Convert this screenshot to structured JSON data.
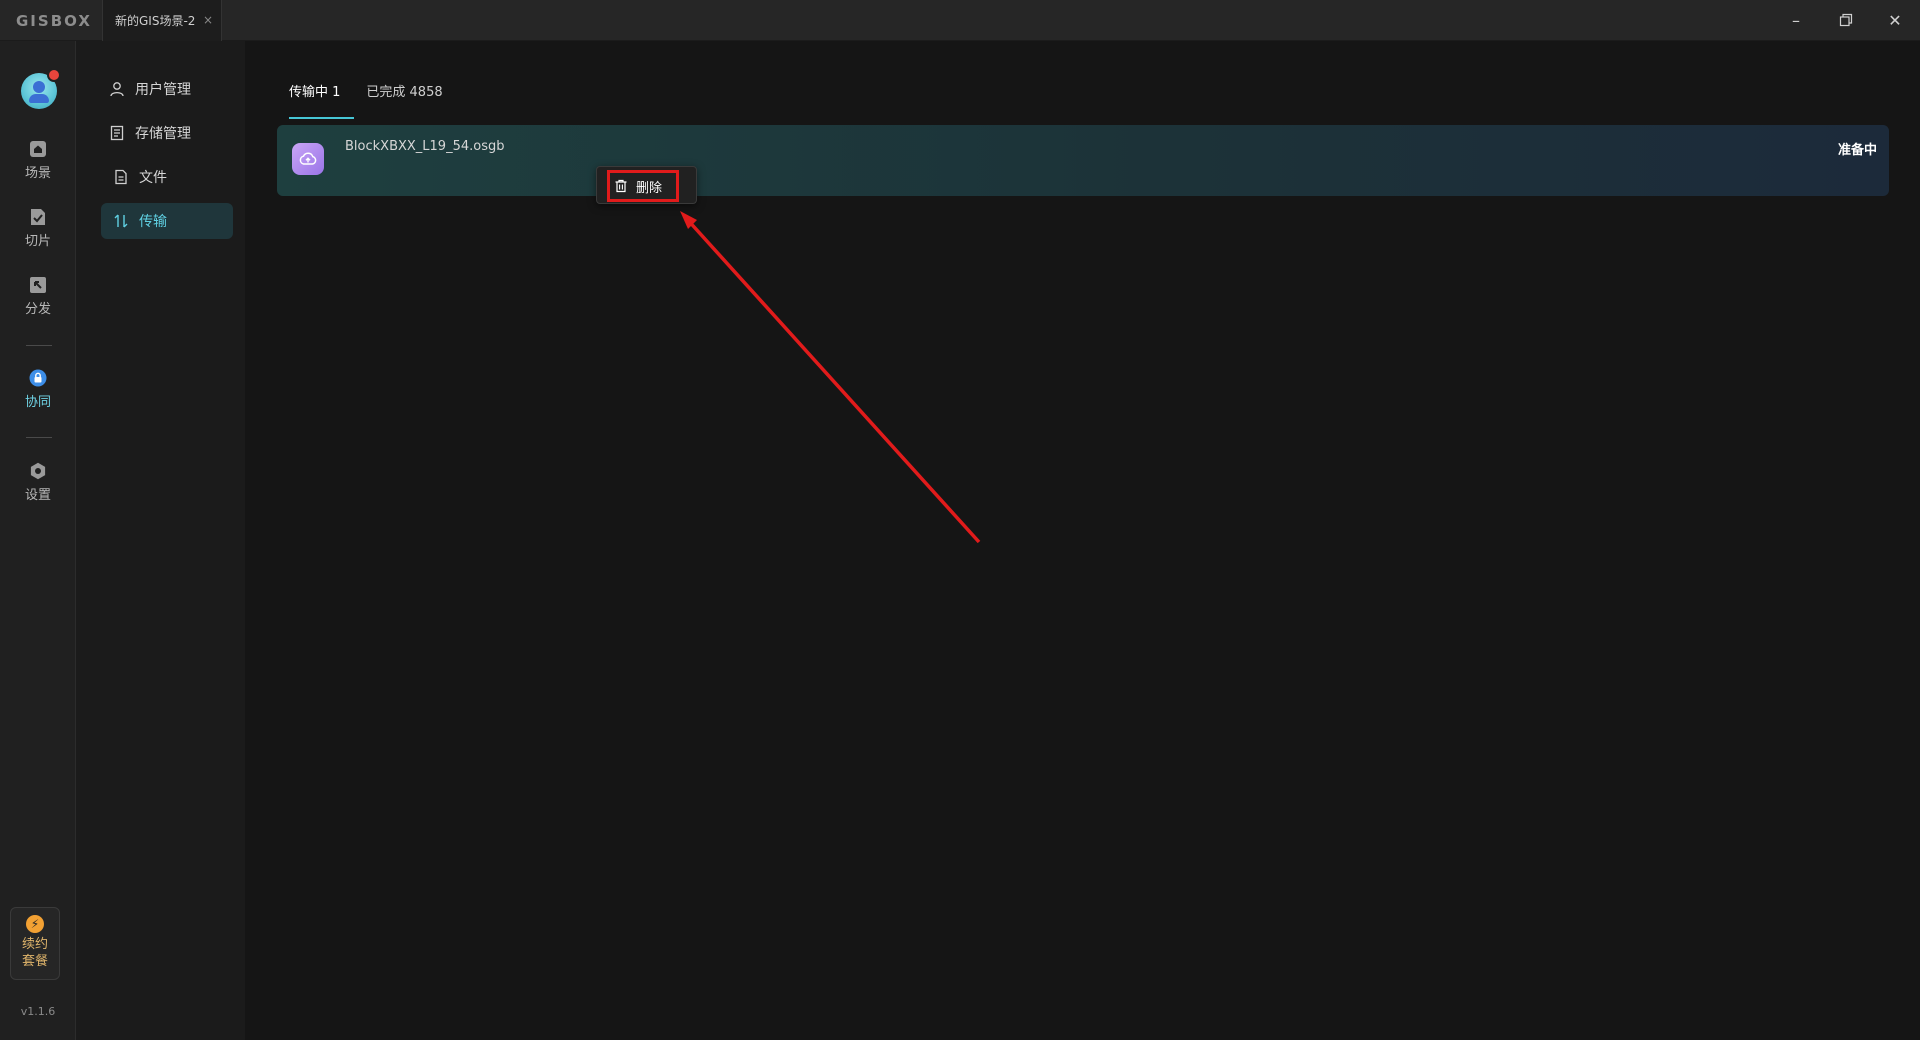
{
  "titlebar": {
    "logo": "GISBOX",
    "doc_tab": "新的GIS场景-2",
    "tab_close": "×",
    "minimize": "–",
    "close": "✕"
  },
  "rail": {
    "items": [
      {
        "label": "场景",
        "icon": "home-icon"
      },
      {
        "label": "切片",
        "icon": "clip-icon"
      },
      {
        "label": "分发",
        "icon": "distribute-icon"
      },
      {
        "label": "协同",
        "icon": "lock-icon"
      },
      {
        "label": "设置",
        "icon": "gear-icon"
      }
    ],
    "renew_line1": "续约",
    "renew_line2": "套餐",
    "renew_icon": "bolt-icon",
    "version": "v1.1.6"
  },
  "submenu": {
    "items": [
      {
        "label": "用户管理",
        "icon": "user-icon"
      },
      {
        "label": "存储管理",
        "icon": "storage-icon"
      },
      {
        "label": "文件",
        "icon": "file-icon"
      },
      {
        "label": "传输",
        "icon": "transfer-icon"
      }
    ]
  },
  "main": {
    "tabs": [
      {
        "label": "传输中 1"
      },
      {
        "label": "已完成 4858"
      }
    ],
    "transfers": [
      {
        "name": "BlockXBXX_L19_54.osgb",
        "status": "准备中"
      }
    ],
    "context_menu": {
      "delete_label": "删除"
    }
  },
  "colors": {
    "accent": "#46c6d6",
    "annotation": "#e11b1b"
  }
}
